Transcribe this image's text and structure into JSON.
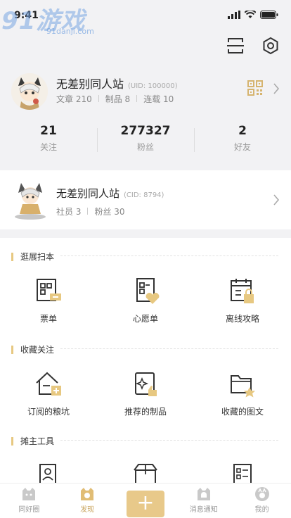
{
  "status": {
    "time": "9:41"
  },
  "watermark": {
    "logo": "91游戏",
    "url": "91danji.com"
  },
  "colors": {
    "accent": "#e7c881",
    "text": "#333333",
    "muted": "#999999"
  },
  "header": {
    "icons": [
      "scan-icon",
      "settings-icon"
    ]
  },
  "profile": {
    "name": "无差别同人站",
    "uid": "(UID: 100000)",
    "articles": "文章 210",
    "products": "制品 8",
    "serials": "连载 10"
  },
  "counts": [
    {
      "value": "21",
      "label": "关注"
    },
    {
      "value": "277327",
      "label": "粉丝"
    },
    {
      "value": "2",
      "label": "好友"
    }
  ],
  "circle": {
    "name": "无差别同人站",
    "cid": "(CID: 8794)",
    "members": "社员 3",
    "fans": "粉丝 30"
  },
  "sections": [
    {
      "title": "逛展扫本",
      "items": [
        "票单",
        "心愿单",
        "离线攻略"
      ]
    },
    {
      "title": "收藏关注",
      "items": [
        "订阅的粮坑",
        "推荐的制品",
        "收藏的图文"
      ]
    },
    {
      "title": "摊主工具"
    }
  ],
  "tabs": [
    {
      "label": "同好圈"
    },
    {
      "label": "发现"
    },
    {
      "label": "+"
    },
    {
      "label": "消息通知"
    },
    {
      "label": "我的"
    }
  ]
}
